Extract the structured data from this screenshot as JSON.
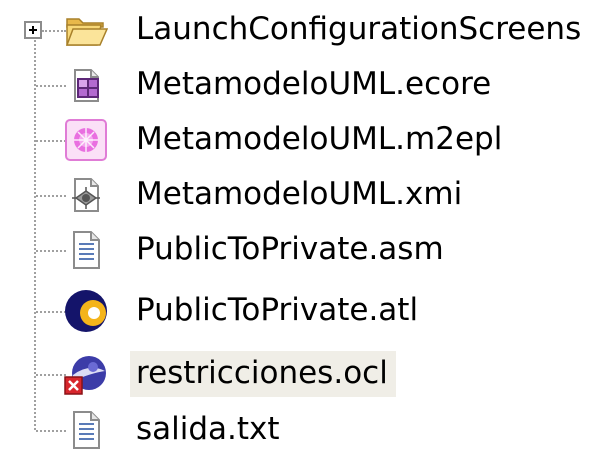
{
  "tree": {
    "items": [
      {
        "label": "LaunchConfigurationScreens",
        "icon": "folder-icon",
        "expandable": true,
        "selected": false
      },
      {
        "label": "MetamodeloUML.ecore",
        "icon": "ecore-model-icon",
        "expandable": false,
        "selected": false
      },
      {
        "label": "MetamodeloUML.m2epl",
        "icon": "m2epl-file-icon",
        "expandable": false,
        "selected": false
      },
      {
        "label": "MetamodeloUML.xmi",
        "icon": "xmi-file-icon",
        "expandable": false,
        "selected": false
      },
      {
        "label": "PublicToPrivate.asm",
        "icon": "text-file-icon",
        "expandable": false,
        "selected": false
      },
      {
        "label": "PublicToPrivate.atl",
        "icon": "atl-file-icon",
        "expandable": false,
        "selected": false
      },
      {
        "label": "restricciones.ocl",
        "icon": "ocl-file-error-icon",
        "expandable": false,
        "selected": true
      },
      {
        "label": "salida.txt",
        "icon": "text-file-icon",
        "expandable": false,
        "selected": false
      }
    ]
  },
  "colors": {
    "selection_background": "#f0eee7",
    "tree_lines": "#a0a0a0",
    "folder": "#f3c95a",
    "error_badge": "#d8262c"
  }
}
